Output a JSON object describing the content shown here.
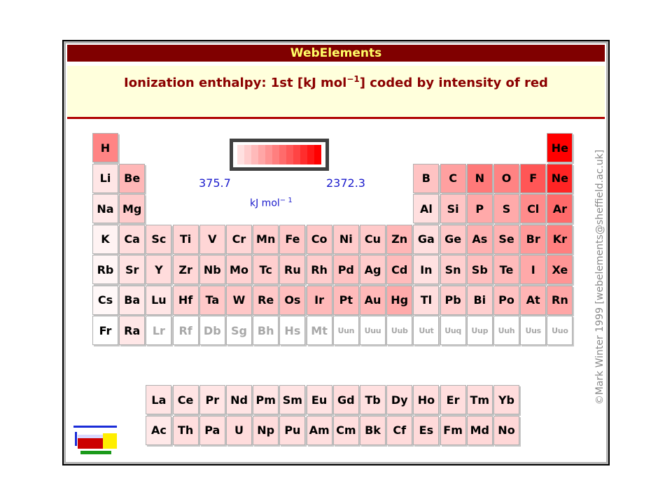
{
  "window": {
    "title": "WebElements"
  },
  "header": {
    "title_pre": "Ionization enthalpy: 1st [kJ mol",
    "title_sup": "−1",
    "title_post": "] coded by intensity of red"
  },
  "scale": {
    "min_label": "375.7",
    "max_label": "2372.3",
    "unit_text": "kJ mol",
    "unit_sup": "− 1",
    "colors": [
      "#ffe0e0",
      "#ffcdcd",
      "#ffbaba",
      "#ffa6a6",
      "#ff9393",
      "#ff7f7f",
      "#ff6b6b",
      "#ff5858",
      "#ff4444",
      "#ff2d2d",
      "#ff1717",
      "#ff0000"
    ]
  },
  "copyright": "©Mark Winter 1999 [webelements@sheffield.ac.uk]",
  "elements": [
    {
      "sym": "H",
      "r": 1,
      "c": 1,
      "ie": 1312
    },
    {
      "sym": "He",
      "r": 1,
      "c": 18,
      "ie": 2372
    },
    {
      "sym": "Li",
      "r": 2,
      "c": 1,
      "ie": 520
    },
    {
      "sym": "Be",
      "r": 2,
      "c": 2,
      "ie": 900
    },
    {
      "sym": "B",
      "r": 2,
      "c": 13,
      "ie": 801
    },
    {
      "sym": "C",
      "r": 2,
      "c": 14,
      "ie": 1086
    },
    {
      "sym": "N",
      "r": 2,
      "c": 15,
      "ie": 1402
    },
    {
      "sym": "O",
      "r": 2,
      "c": 16,
      "ie": 1314
    },
    {
      "sym": "F",
      "r": 2,
      "c": 17,
      "ie": 1681
    },
    {
      "sym": "Ne",
      "r": 2,
      "c": 18,
      "ie": 2081
    },
    {
      "sym": "Na",
      "r": 3,
      "c": 1,
      "ie": 496
    },
    {
      "sym": "Mg",
      "r": 3,
      "c": 2,
      "ie": 738
    },
    {
      "sym": "Al",
      "r": 3,
      "c": 13,
      "ie": 578
    },
    {
      "sym": "Si",
      "r": 3,
      "c": 14,
      "ie": 787
    },
    {
      "sym": "P",
      "r": 3,
      "c": 15,
      "ie": 1012
    },
    {
      "sym": "S",
      "r": 3,
      "c": 16,
      "ie": 1000
    },
    {
      "sym": "Cl",
      "r": 3,
      "c": 17,
      "ie": 1251
    },
    {
      "sym": "Ar",
      "r": 3,
      "c": 18,
      "ie": 1521
    },
    {
      "sym": "K",
      "r": 4,
      "c": 1,
      "ie": 419
    },
    {
      "sym": "Ca",
      "r": 4,
      "c": 2,
      "ie": 590
    },
    {
      "sym": "Sc",
      "r": 4,
      "c": 3,
      "ie": 633
    },
    {
      "sym": "Ti",
      "r": 4,
      "c": 4,
      "ie": 659
    },
    {
      "sym": "V",
      "r": 4,
      "c": 5,
      "ie": 651
    },
    {
      "sym": "Cr",
      "r": 4,
      "c": 6,
      "ie": 653
    },
    {
      "sym": "Mn",
      "r": 4,
      "c": 7,
      "ie": 717
    },
    {
      "sym": "Fe",
      "r": 4,
      "c": 8,
      "ie": 762
    },
    {
      "sym": "Co",
      "r": 4,
      "c": 9,
      "ie": 760
    },
    {
      "sym": "Ni",
      "r": 4,
      "c": 10,
      "ie": 737
    },
    {
      "sym": "Cu",
      "r": 4,
      "c": 11,
      "ie": 745
    },
    {
      "sym": "Zn",
      "r": 4,
      "c": 12,
      "ie": 906
    },
    {
      "sym": "Ga",
      "r": 4,
      "c": 13,
      "ie": 579
    },
    {
      "sym": "Ge",
      "r": 4,
      "c": 14,
      "ie": 762
    },
    {
      "sym": "As",
      "r": 4,
      "c": 15,
      "ie": 947
    },
    {
      "sym": "Se",
      "r": 4,
      "c": 16,
      "ie": 941
    },
    {
      "sym": "Br",
      "r": 4,
      "c": 17,
      "ie": 1140
    },
    {
      "sym": "Kr",
      "r": 4,
      "c": 18,
      "ie": 1351
    },
    {
      "sym": "Rb",
      "r": 5,
      "c": 1,
      "ie": 403
    },
    {
      "sym": "Sr",
      "r": 5,
      "c": 2,
      "ie": 550
    },
    {
      "sym": "Y",
      "r": 5,
      "c": 3,
      "ie": 600
    },
    {
      "sym": "Zr",
      "r": 5,
      "c": 4,
      "ie": 640
    },
    {
      "sym": "Nb",
      "r": 5,
      "c": 5,
      "ie": 652
    },
    {
      "sym": "Mo",
      "r": 5,
      "c": 6,
      "ie": 684
    },
    {
      "sym": "Tc",
      "r": 5,
      "c": 7,
      "ie": 702
    },
    {
      "sym": "Ru",
      "r": 5,
      "c": 8,
      "ie": 710
    },
    {
      "sym": "Rh",
      "r": 5,
      "c": 9,
      "ie": 720
    },
    {
      "sym": "Pd",
      "r": 5,
      "c": 10,
      "ie": 804
    },
    {
      "sym": "Ag",
      "r": 5,
      "c": 11,
      "ie": 731
    },
    {
      "sym": "Cd",
      "r": 5,
      "c": 12,
      "ie": 868
    },
    {
      "sym": "In",
      "r": 5,
      "c": 13,
      "ie": 558
    },
    {
      "sym": "Sn",
      "r": 5,
      "c": 14,
      "ie": 709
    },
    {
      "sym": "Sb",
      "r": 5,
      "c": 15,
      "ie": 834
    },
    {
      "sym": "Te",
      "r": 5,
      "c": 16,
      "ie": 869
    },
    {
      "sym": "I",
      "r": 5,
      "c": 17,
      "ie": 1008
    },
    {
      "sym": "Xe",
      "r": 5,
      "c": 18,
      "ie": 1170
    },
    {
      "sym": "Cs",
      "r": 6,
      "c": 1,
      "ie": 376
    },
    {
      "sym": "Ba",
      "r": 6,
      "c": 2,
      "ie": 503
    },
    {
      "sym": "Lu",
      "r": 6,
      "c": 3,
      "ie": 524
    },
    {
      "sym": "Hf",
      "r": 6,
      "c": 4,
      "ie": 659
    },
    {
      "sym": "Ta",
      "r": 6,
      "c": 5,
      "ie": 761
    },
    {
      "sym": "W",
      "r": 6,
      "c": 6,
      "ie": 770
    },
    {
      "sym": "Re",
      "r": 6,
      "c": 7,
      "ie": 760
    },
    {
      "sym": "Os",
      "r": 6,
      "c": 8,
      "ie": 840
    },
    {
      "sym": "Ir",
      "r": 6,
      "c": 9,
      "ie": 880
    },
    {
      "sym": "Pt",
      "r": 6,
      "c": 10,
      "ie": 870
    },
    {
      "sym": "Au",
      "r": 6,
      "c": 11,
      "ie": 890
    },
    {
      "sym": "Hg",
      "r": 6,
      "c": 12,
      "ie": 1007
    },
    {
      "sym": "Tl",
      "r": 6,
      "c": 13,
      "ie": 589
    },
    {
      "sym": "Pb",
      "r": 6,
      "c": 14,
      "ie": 716
    },
    {
      "sym": "Bi",
      "r": 6,
      "c": 15,
      "ie": 703
    },
    {
      "sym": "Po",
      "r": 6,
      "c": 16,
      "ie": 812
    },
    {
      "sym": "At",
      "r": 6,
      "c": 17,
      "ie": 920
    },
    {
      "sym": "Rn",
      "r": 6,
      "c": 18,
      "ie": 1037
    },
    {
      "sym": "Fr",
      "r": 7,
      "c": 1,
      "ie": null
    },
    {
      "sym": "Ra",
      "r": 7,
      "c": 2,
      "ie": 509
    },
    {
      "sym": "Lr",
      "r": 7,
      "c": 3,
      "ie": null,
      "gray": true
    },
    {
      "sym": "Rf",
      "r": 7,
      "c": 4,
      "ie": null,
      "gray": true
    },
    {
      "sym": "Db",
      "r": 7,
      "c": 5,
      "ie": null,
      "gray": true
    },
    {
      "sym": "Sg",
      "r": 7,
      "c": 6,
      "ie": null,
      "gray": true
    },
    {
      "sym": "Bh",
      "r": 7,
      "c": 7,
      "ie": null,
      "gray": true
    },
    {
      "sym": "Hs",
      "r": 7,
      "c": 8,
      "ie": null,
      "gray": true
    },
    {
      "sym": "Mt",
      "r": 7,
      "c": 9,
      "ie": null,
      "gray": true
    },
    {
      "sym": "Uun",
      "r": 7,
      "c": 10,
      "ie": null,
      "gray": true,
      "small": true
    },
    {
      "sym": "Uuu",
      "r": 7,
      "c": 11,
      "ie": null,
      "gray": true,
      "small": true
    },
    {
      "sym": "Uub",
      "r": 7,
      "c": 12,
      "ie": null,
      "gray": true,
      "small": true
    },
    {
      "sym": "Uut",
      "r": 7,
      "c": 13,
      "ie": null,
      "gray": true,
      "small": true
    },
    {
      "sym": "Uuq",
      "r": 7,
      "c": 14,
      "ie": null,
      "gray": true,
      "small": true
    },
    {
      "sym": "Uup",
      "r": 7,
      "c": 15,
      "ie": null,
      "gray": true,
      "small": true
    },
    {
      "sym": "Uuh",
      "r": 7,
      "c": 16,
      "ie": null,
      "gray": true,
      "small": true
    },
    {
      "sym": "Uus",
      "r": 7,
      "c": 17,
      "ie": null,
      "gray": true,
      "small": true
    },
    {
      "sym": "Uuo",
      "r": 7,
      "c": 18,
      "ie": null,
      "gray": true,
      "small": true
    },
    {
      "sym": "La",
      "r": 9,
      "c": 3,
      "ie": 538
    },
    {
      "sym": "Ce",
      "r": 9,
      "c": 4,
      "ie": 534
    },
    {
      "sym": "Pr",
      "r": 9,
      "c": 5,
      "ie": 527
    },
    {
      "sym": "Nd",
      "r": 9,
      "c": 6,
      "ie": 533
    },
    {
      "sym": "Pm",
      "r": 9,
      "c": 7,
      "ie": 540
    },
    {
      "sym": "Sm",
      "r": 9,
      "c": 8,
      "ie": 545
    },
    {
      "sym": "Eu",
      "r": 9,
      "c": 9,
      "ie": 547
    },
    {
      "sym": "Gd",
      "r": 9,
      "c": 10,
      "ie": 593
    },
    {
      "sym": "Tb",
      "r": 9,
      "c": 11,
      "ie": 566
    },
    {
      "sym": "Dy",
      "r": 9,
      "c": 12,
      "ie": 573
    },
    {
      "sym": "Ho",
      "r": 9,
      "c": 13,
      "ie": 581
    },
    {
      "sym": "Er",
      "r": 9,
      "c": 14,
      "ie": 589
    },
    {
      "sym": "Tm",
      "r": 9,
      "c": 15,
      "ie": 597
    },
    {
      "sym": "Yb",
      "r": 9,
      "c": 16,
      "ie": 603
    },
    {
      "sym": "Ac",
      "r": 10,
      "c": 3,
      "ie": 499
    },
    {
      "sym": "Th",
      "r": 10,
      "c": 4,
      "ie": 587
    },
    {
      "sym": "Pa",
      "r": 10,
      "c": 5,
      "ie": 568
    },
    {
      "sym": "U",
      "r": 10,
      "c": 6,
      "ie": 598
    },
    {
      "sym": "Np",
      "r": 10,
      "c": 7,
      "ie": 605
    },
    {
      "sym": "Pu",
      "r": 10,
      "c": 8,
      "ie": 585
    },
    {
      "sym": "Am",
      "r": 10,
      "c": 9,
      "ie": 578
    },
    {
      "sym": "Cm",
      "r": 10,
      "c": 10,
      "ie": 581
    },
    {
      "sym": "Bk",
      "r": 10,
      "c": 11,
      "ie": 601
    },
    {
      "sym": "Cf",
      "r": 10,
      "c": 12,
      "ie": 608
    },
    {
      "sym": "Es",
      "r": 10,
      "c": 13,
      "ie": 619
    },
    {
      "sym": "Fm",
      "r": 10,
      "c": 14,
      "ie": 627
    },
    {
      "sym": "Md",
      "r": 10,
      "c": 15,
      "ie": 635
    },
    {
      "sym": "No",
      "r": 10,
      "c": 16,
      "ie": 642
    }
  ]
}
